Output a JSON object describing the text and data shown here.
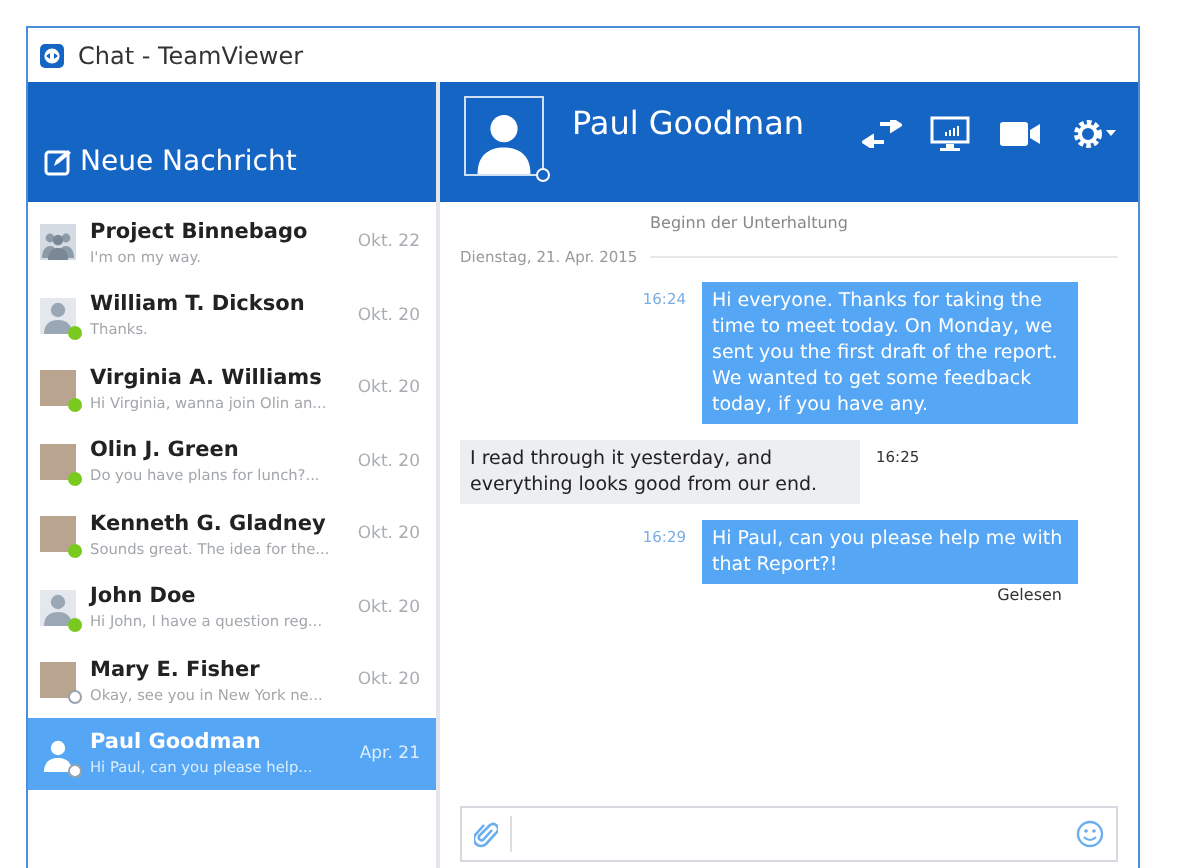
{
  "window": {
    "title": "Chat - TeamViewer"
  },
  "new_message": {
    "label": "Neue Nachricht"
  },
  "contacts": [
    {
      "name": "Project Binnebago",
      "preview": "I'm on my way.",
      "date": "Okt. 22",
      "kind": "group",
      "selected": false
    },
    {
      "name": "William T. Dickson",
      "preview": "Thanks.",
      "date": "Okt. 20",
      "kind": "person",
      "online": true,
      "selected": false
    },
    {
      "name": "Virginia A. Williams",
      "preview": "Hi Virginia, wanna join Olin an...",
      "date": "Okt. 20",
      "kind": "photo",
      "online": true,
      "selected": false
    },
    {
      "name": "Olin J. Green",
      "preview": "Do you have plans for lunch?...",
      "date": "Okt. 20",
      "kind": "photo",
      "online": true,
      "selected": false
    },
    {
      "name": "Kenneth G. Gladney",
      "preview": "Sounds great. The idea for the...",
      "date": "Okt. 20",
      "kind": "photo",
      "online": true,
      "selected": false
    },
    {
      "name": "John Doe",
      "preview": "Hi John, I have a question reg...",
      "date": "Okt. 20",
      "kind": "person",
      "online": true,
      "selected": false
    },
    {
      "name": "Mary E. Fisher",
      "preview": "Okay, see you in New York ne...",
      "date": "Okt. 20",
      "kind": "photo",
      "online": false,
      "selected": false
    },
    {
      "name": "Paul Goodman",
      "preview": "Hi Paul, can you please help...",
      "date": "Apr. 21",
      "kind": "person",
      "online": false,
      "selected": true
    }
  ],
  "chat": {
    "name": "Paul Goodman",
    "online": false,
    "start_note": "Beginn der Unterhaltung",
    "date_separator": "Dienstag, 21. Apr. 2015",
    "messages": [
      {
        "kind": "sent",
        "time": "16:24",
        "text": "Hi everyone. Thanks for taking the time to meet today. On Monday, we sent you the first draft of the report. We wanted to get some feedback today, if you have any."
      },
      {
        "kind": "received",
        "time": "16:25",
        "text": "I read through it yesterday, and everything looks good from our end."
      },
      {
        "kind": "sent",
        "time": "16:29",
        "text": "Hi Paul, can you please help me with that Report?!",
        "receipt": "Gelesen"
      }
    ]
  }
}
